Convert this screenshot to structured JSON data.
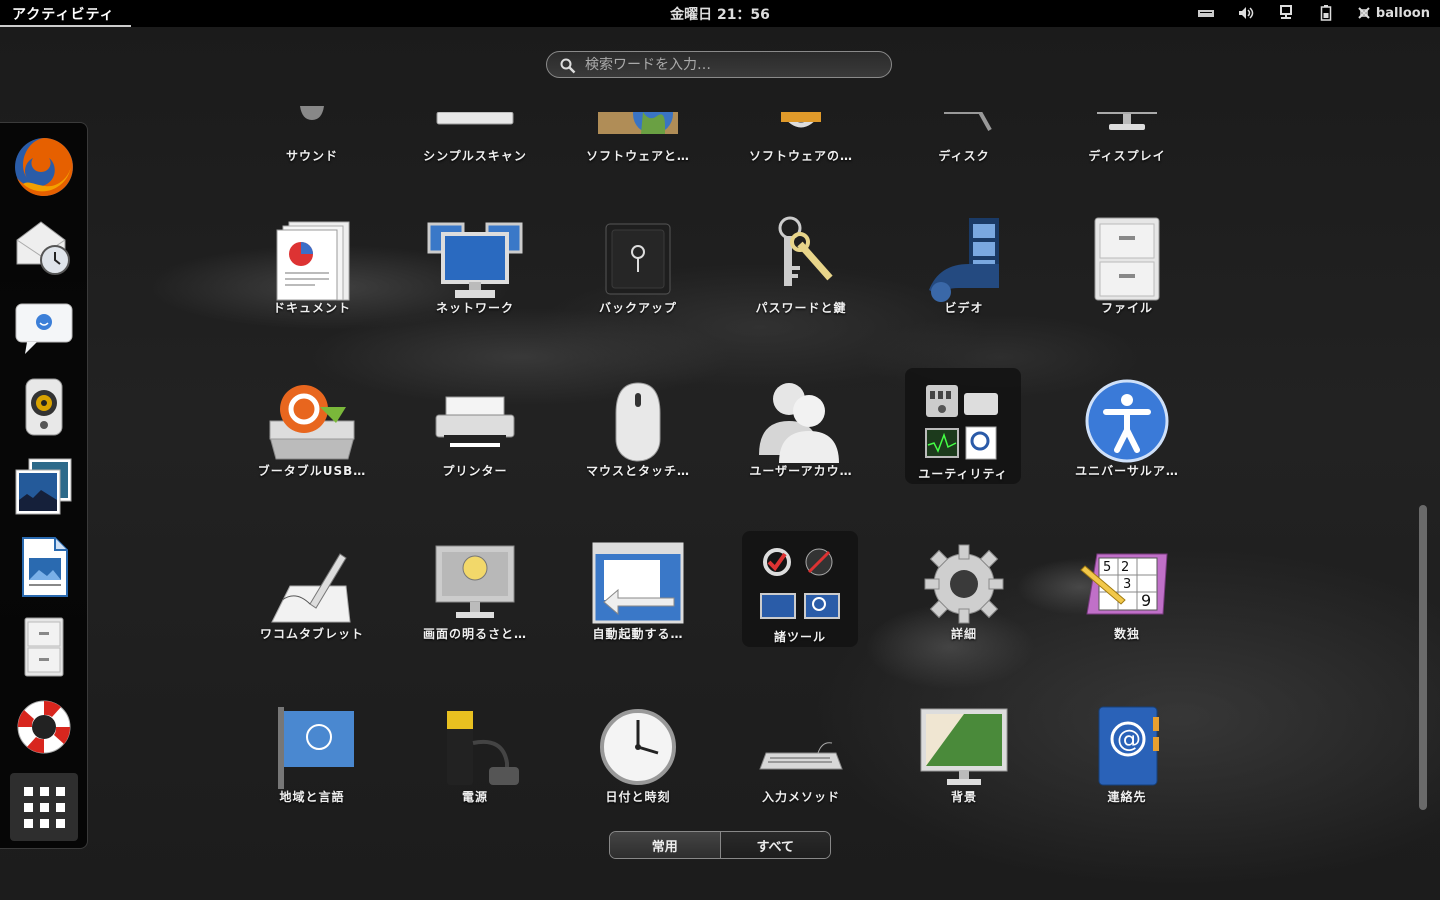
{
  "topbar": {
    "activities": "アクティビティ",
    "clock": "金曜日 21：56",
    "user": "balloon"
  },
  "search": {
    "placeholder": "検索ワードを入力…"
  },
  "dash": [
    "firefox",
    "mail-clock",
    "empathy-chat",
    "rhythmbox-speaker",
    "shotwell-photos",
    "libreoffice-writer",
    "file-cabinet",
    "help-lifebuoy",
    "show-apps-grid"
  ],
  "apps": {
    "row0": [
      "サウンド",
      "シンプルスキャン",
      "ソフトウェアと…",
      "ソフトウェアの…",
      "ディスク",
      "ディスプレイ"
    ],
    "row1": [
      "ドキュメント",
      "ネットワーク",
      "バックアップ",
      "パスワードと鍵",
      "ビデオ",
      "ファイル"
    ],
    "row2": [
      "ブータブルUSB…",
      "プリンター",
      "マウスとタッチ…",
      "ユーザーアカウ…",
      "ユーティリティ",
      "ユニバーサルア…"
    ],
    "row3": [
      "ワコムタブレット",
      "画面の明るさと…",
      "自動起動する…",
      "諸ツール",
      "詳細",
      "数独"
    ],
    "row4": [
      "地域と言語",
      "電源",
      "日付と時刻",
      "入力メソッド",
      "背景",
      "連絡先"
    ]
  },
  "toggle": {
    "frequent": "常用",
    "all": "すべて"
  }
}
